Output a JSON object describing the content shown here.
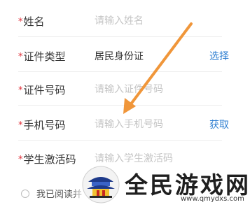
{
  "form": {
    "fields": [
      {
        "required_mark": "*",
        "label": "姓名",
        "placeholder": "请输入姓名",
        "value": "",
        "action": ""
      },
      {
        "required_mark": "*",
        "label": "证件类型",
        "placeholder": "",
        "value": "居民身份证",
        "action": "选择"
      },
      {
        "required_mark": "*",
        "label": "证件号码",
        "placeholder": "请输入证件号码",
        "value": "",
        "action": ""
      },
      {
        "required_mark": "*",
        "label": "手机号码",
        "placeholder": "请输入手机号码",
        "value": "",
        "action": "获取"
      },
      {
        "required_mark": "*",
        "label": "学生激活码",
        "placeholder": "请输入学生激活码",
        "value": "",
        "action": ""
      }
    ],
    "agreement": {
      "text": "我已阅读并",
      "checked": false
    }
  },
  "watermark": {
    "title": "全民游戏网",
    "url": "www.qmydxs.com",
    "logo_icon": "pagoda-logo-icon"
  },
  "colors": {
    "required": "#e0303a",
    "link": "#2f7fd1",
    "annotation_arrow": "#f0963a",
    "placeholder": "#c5c5c5"
  }
}
